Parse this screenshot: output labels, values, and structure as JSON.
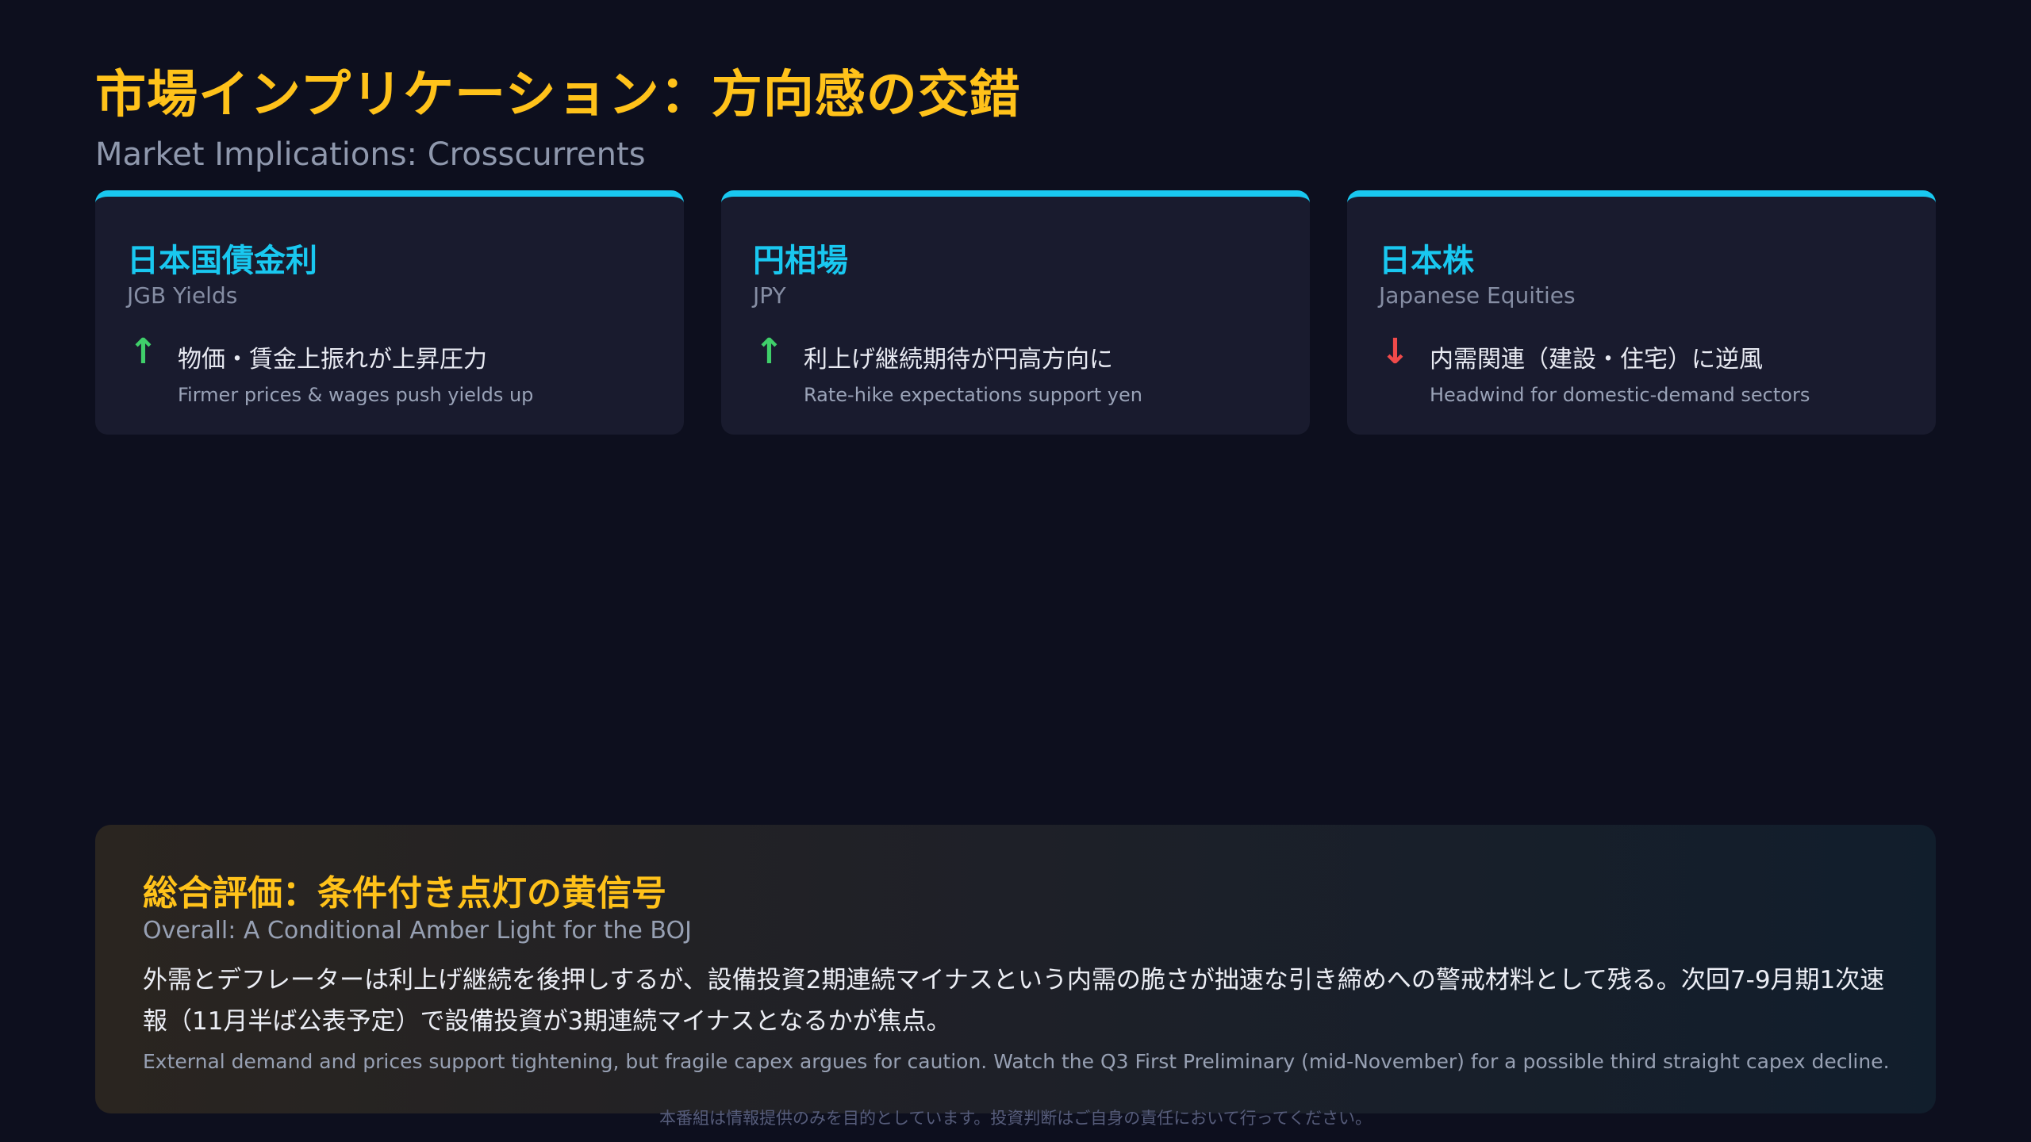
{
  "header": {
    "title": "市場インプリケーション：方向感の交錯",
    "subtitle": "Market Implications: Crosscurrents"
  },
  "cards": [
    {
      "title": "日本国債金利",
      "subtitle": "JGB Yields",
      "arrow": "↑",
      "direction": "up",
      "point": "物価・賃金上振れが上昇圧力",
      "point_en": "Firmer prices & wages push yields up"
    },
    {
      "title": "円相場",
      "subtitle": "JPY",
      "arrow": "↑",
      "direction": "up",
      "point": "利上げ継続期待が円高方向に",
      "point_en": "Rate-hike expectations support yen"
    },
    {
      "title": "日本株",
      "subtitle": "Japanese Equities",
      "arrow": "↓",
      "direction": "down",
      "point": "内需関連（建設・住宅）に逆風",
      "point_en": "Headwind for domestic-demand sectors"
    }
  ],
  "summary": {
    "title": "総合評価：条件付き点灯の黄信号",
    "subtitle": "Overall: A Conditional Amber Light for the BOJ",
    "body": "外需とデフレーターは利上げ継続を後押しするが、設備投資2期連続マイナスという内需の脆さが拙速な引き締めへの警戒材料として残る。次回7-9月期1次速報（11月半ば公表予定）で設備投資が3期連続マイナスとなるかが焦点。",
    "body_en": "External demand and prices support tightening, but fragile capex argues for caution. Watch the Q3 First Preliminary (mid-November) for a possible third straight capex decline."
  },
  "footer": {
    "disclaimer": "本番組は情報提供のみを目的としています。投資判断はご自身の責任において行ってください。"
  },
  "colors": {
    "background": "#0d0f1e",
    "accent_gold": "#ffc21a",
    "accent_cyan": "#19c8f0",
    "up_green": "#3fcf6a",
    "down_red": "#f04a4a"
  }
}
